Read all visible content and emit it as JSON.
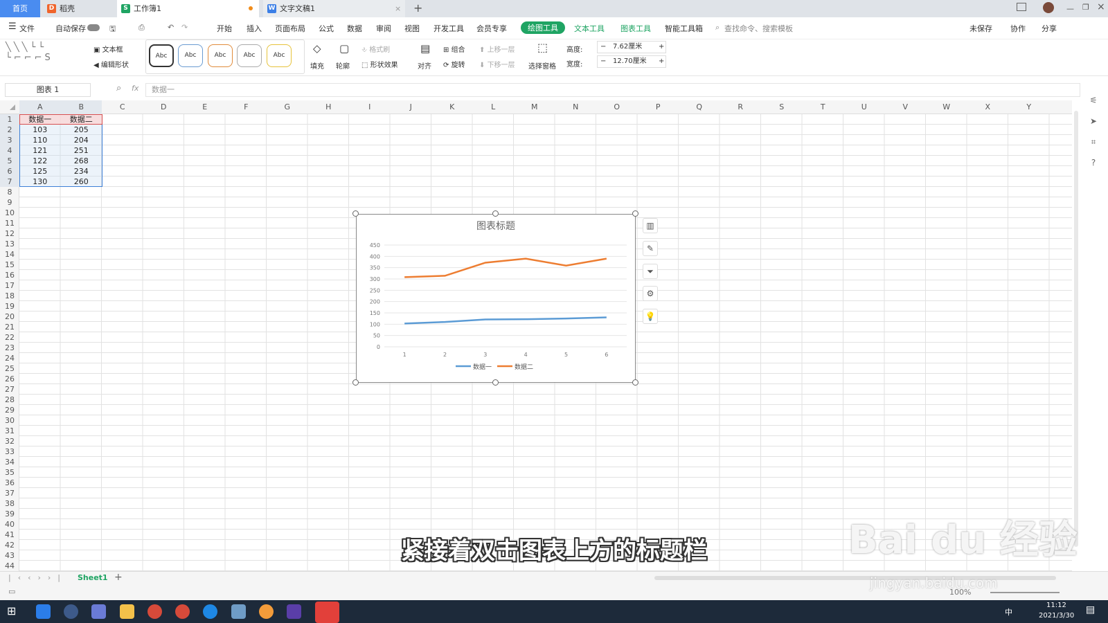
{
  "tabs": [
    {
      "label": "首页"
    },
    {
      "label": "稻壳"
    },
    {
      "label": "工作簿1"
    },
    {
      "label": "文字文稿1"
    }
  ],
  "menu": {
    "file": "文件",
    "autosave": "自动保存",
    "items": [
      "开始",
      "插入",
      "页面布局",
      "公式",
      "数据",
      "审阅",
      "视图",
      "开发工具",
      "会员专享",
      "绘图工具",
      "文本工具",
      "图表工具",
      "智能工具箱"
    ],
    "search": "查找命令、搜索模板",
    "unsaved": "未保存",
    "collab": "协作",
    "share": "分享"
  },
  "ribbon": {
    "textbox": "文本框",
    "edit_shape": "编辑形状",
    "styles": [
      "Abc",
      "Abc",
      "Abc",
      "Abc",
      "Abc"
    ],
    "fill": "填充",
    "outline": "轮廓",
    "format_brush": "格式刷",
    "shape_effect": "形状效果",
    "align": "对齐",
    "group": "组合",
    "rotate": "旋转",
    "bring_forward": "上移一层",
    "send_backward": "下移一层",
    "select_pane": "选择窗格",
    "height_label": "高度:",
    "height_value": "7.62厘米",
    "width_label": "宽度:",
    "width_value": "12.70厘米"
  },
  "formula": {
    "namebox": "图表 1",
    "fx": "fx",
    "content": "数据一"
  },
  "columns": [
    "A",
    "B",
    "C",
    "D",
    "E",
    "F",
    "G",
    "H",
    "I",
    "J",
    "K",
    "L",
    "M",
    "N",
    "O",
    "P",
    "Q",
    "R",
    "S",
    "T",
    "U",
    "V",
    "W",
    "X",
    "Y"
  ],
  "table": {
    "headers": [
      "数据一",
      "数据二"
    ],
    "rows": [
      [
        "103",
        "205"
      ],
      [
        "110",
        "204"
      ],
      [
        "121",
        "251"
      ],
      [
        "122",
        "268"
      ],
      [
        "125",
        "234"
      ],
      [
        "130",
        "260"
      ]
    ]
  },
  "chart_data": {
    "type": "line",
    "title": "图表标题",
    "categories": [
      "1",
      "2",
      "3",
      "4",
      "5",
      "6"
    ],
    "series": [
      {
        "name": "数据一",
        "values": [
          103,
          110,
          121,
          122,
          125,
          130
        ],
        "color": "#5b9bd5"
      },
      {
        "name": "数据二",
        "values": [
          308,
          314,
          372,
          390,
          359,
          390
        ],
        "color": "#ed7d31"
      }
    ],
    "ylim": [
      0,
      450
    ],
    "yticks": [
      "0",
      "50",
      "100",
      "150",
      "200",
      "250",
      "300",
      "350",
      "400",
      "450"
    ],
    "grid": true,
    "legend": "bottom"
  },
  "sheet": {
    "name": "Sheet1",
    "zoom": "100%"
  },
  "subtitle": "紧接着双击图表上方的标题栏",
  "watermark": {
    "main": "Bai du 经验",
    "url": "jingyan.baidu.com"
  },
  "taskbar": {
    "time": "11:12",
    "date": "2021/3/30",
    "ime": "中"
  }
}
